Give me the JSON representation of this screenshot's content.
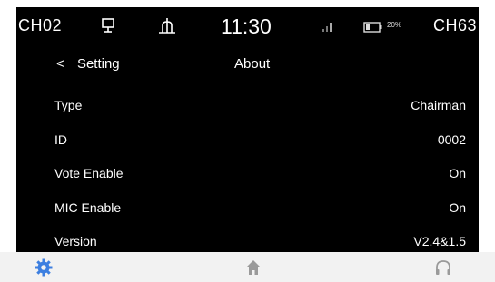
{
  "status": {
    "left_channel": "CH02",
    "right_channel": "CH63",
    "time": "11:30",
    "battery_percent": "20%",
    "icons": [
      "monitor-icon",
      "microphone-stand-icon",
      "signal-icon",
      "battery-icon"
    ]
  },
  "nav": {
    "back_label": "Setting",
    "title": "About"
  },
  "rows": [
    {
      "label": "Type",
      "value": "Chairman"
    },
    {
      "label": "ID",
      "value": "0002"
    },
    {
      "label": "Vote Enable",
      "value": "On"
    },
    {
      "label": "MIC Enable",
      "value": "On"
    },
    {
      "label": "Version",
      "value": "V2.4&1.5"
    }
  ],
  "tabs": [
    "settings-icon",
    "home-icon",
    "headphones-icon"
  ],
  "colors": {
    "background": "#000000",
    "bottom_bar": "#f2f2f2",
    "active_tab": "#3d7fe0",
    "inactive_tab": "#9a9a9a"
  }
}
